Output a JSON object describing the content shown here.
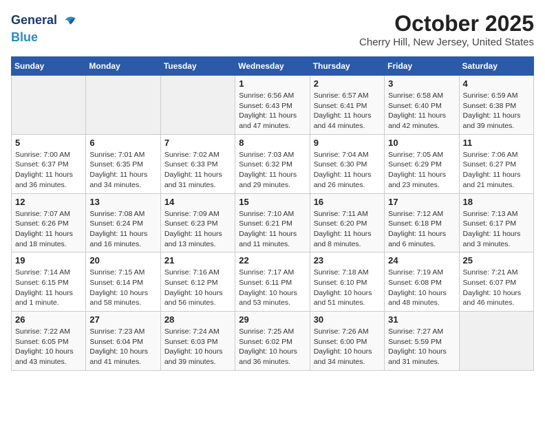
{
  "header": {
    "logo_line1": "General",
    "logo_line2": "Blue",
    "month_title": "October 2025",
    "location": "Cherry Hill, New Jersey, United States"
  },
  "weekdays": [
    "Sunday",
    "Monday",
    "Tuesday",
    "Wednesday",
    "Thursday",
    "Friday",
    "Saturday"
  ],
  "weeks": [
    [
      {
        "day": "",
        "info": ""
      },
      {
        "day": "",
        "info": ""
      },
      {
        "day": "",
        "info": ""
      },
      {
        "day": "1",
        "info": "Sunrise: 6:56 AM\nSunset: 6:43 PM\nDaylight: 11 hours and 47 minutes."
      },
      {
        "day": "2",
        "info": "Sunrise: 6:57 AM\nSunset: 6:41 PM\nDaylight: 11 hours and 44 minutes."
      },
      {
        "day": "3",
        "info": "Sunrise: 6:58 AM\nSunset: 6:40 PM\nDaylight: 11 hours and 42 minutes."
      },
      {
        "day": "4",
        "info": "Sunrise: 6:59 AM\nSunset: 6:38 PM\nDaylight: 11 hours and 39 minutes."
      }
    ],
    [
      {
        "day": "5",
        "info": "Sunrise: 7:00 AM\nSunset: 6:37 PM\nDaylight: 11 hours and 36 minutes."
      },
      {
        "day": "6",
        "info": "Sunrise: 7:01 AM\nSunset: 6:35 PM\nDaylight: 11 hours and 34 minutes."
      },
      {
        "day": "7",
        "info": "Sunrise: 7:02 AM\nSunset: 6:33 PM\nDaylight: 11 hours and 31 minutes."
      },
      {
        "day": "8",
        "info": "Sunrise: 7:03 AM\nSunset: 6:32 PM\nDaylight: 11 hours and 29 minutes."
      },
      {
        "day": "9",
        "info": "Sunrise: 7:04 AM\nSunset: 6:30 PM\nDaylight: 11 hours and 26 minutes."
      },
      {
        "day": "10",
        "info": "Sunrise: 7:05 AM\nSunset: 6:29 PM\nDaylight: 11 hours and 23 minutes."
      },
      {
        "day": "11",
        "info": "Sunrise: 7:06 AM\nSunset: 6:27 PM\nDaylight: 11 hours and 21 minutes."
      }
    ],
    [
      {
        "day": "12",
        "info": "Sunrise: 7:07 AM\nSunset: 6:26 PM\nDaylight: 11 hours and 18 minutes."
      },
      {
        "day": "13",
        "info": "Sunrise: 7:08 AM\nSunset: 6:24 PM\nDaylight: 11 hours and 16 minutes."
      },
      {
        "day": "14",
        "info": "Sunrise: 7:09 AM\nSunset: 6:23 PM\nDaylight: 11 hours and 13 minutes."
      },
      {
        "day": "15",
        "info": "Sunrise: 7:10 AM\nSunset: 6:21 PM\nDaylight: 11 hours and 11 minutes."
      },
      {
        "day": "16",
        "info": "Sunrise: 7:11 AM\nSunset: 6:20 PM\nDaylight: 11 hours and 8 minutes."
      },
      {
        "day": "17",
        "info": "Sunrise: 7:12 AM\nSunset: 6:18 PM\nDaylight: 11 hours and 6 minutes."
      },
      {
        "day": "18",
        "info": "Sunrise: 7:13 AM\nSunset: 6:17 PM\nDaylight: 11 hours and 3 minutes."
      }
    ],
    [
      {
        "day": "19",
        "info": "Sunrise: 7:14 AM\nSunset: 6:15 PM\nDaylight: 11 hours and 1 minute."
      },
      {
        "day": "20",
        "info": "Sunrise: 7:15 AM\nSunset: 6:14 PM\nDaylight: 10 hours and 58 minutes."
      },
      {
        "day": "21",
        "info": "Sunrise: 7:16 AM\nSunset: 6:12 PM\nDaylight: 10 hours and 56 minutes."
      },
      {
        "day": "22",
        "info": "Sunrise: 7:17 AM\nSunset: 6:11 PM\nDaylight: 10 hours and 53 minutes."
      },
      {
        "day": "23",
        "info": "Sunrise: 7:18 AM\nSunset: 6:10 PM\nDaylight: 10 hours and 51 minutes."
      },
      {
        "day": "24",
        "info": "Sunrise: 7:19 AM\nSunset: 6:08 PM\nDaylight: 10 hours and 48 minutes."
      },
      {
        "day": "25",
        "info": "Sunrise: 7:21 AM\nSunset: 6:07 PM\nDaylight: 10 hours and 46 minutes."
      }
    ],
    [
      {
        "day": "26",
        "info": "Sunrise: 7:22 AM\nSunset: 6:05 PM\nDaylight: 10 hours and 43 minutes."
      },
      {
        "day": "27",
        "info": "Sunrise: 7:23 AM\nSunset: 6:04 PM\nDaylight: 10 hours and 41 minutes."
      },
      {
        "day": "28",
        "info": "Sunrise: 7:24 AM\nSunset: 6:03 PM\nDaylight: 10 hours and 39 minutes."
      },
      {
        "day": "29",
        "info": "Sunrise: 7:25 AM\nSunset: 6:02 PM\nDaylight: 10 hours and 36 minutes."
      },
      {
        "day": "30",
        "info": "Sunrise: 7:26 AM\nSunset: 6:00 PM\nDaylight: 10 hours and 34 minutes."
      },
      {
        "day": "31",
        "info": "Sunrise: 7:27 AM\nSunset: 5:59 PM\nDaylight: 10 hours and 31 minutes."
      },
      {
        "day": "",
        "info": ""
      }
    ]
  ]
}
